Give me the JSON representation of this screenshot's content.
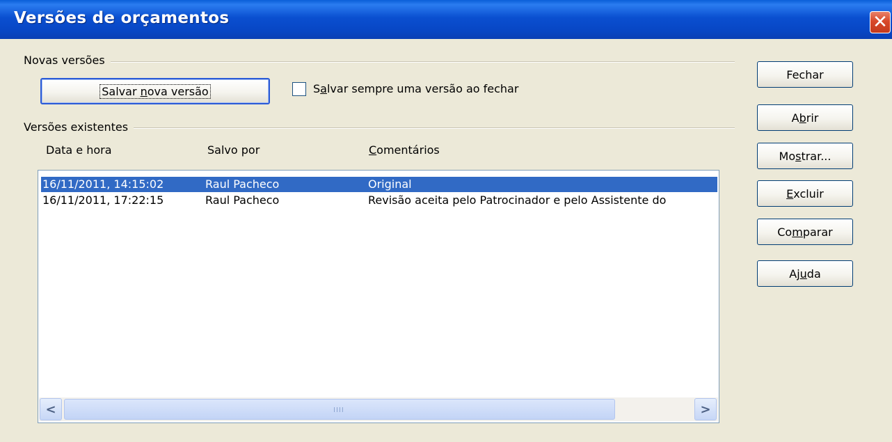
{
  "window": {
    "title": "Versões de orçamentos",
    "close_symbol": "✕"
  },
  "new_versions": {
    "group_label": "Novas versões",
    "save_button": {
      "pre": "Salvar ",
      "underlined": "n",
      "post": "ova versão"
    },
    "always_save": {
      "pre": "S",
      "underlined": "a",
      "post": "lvar sempre uma versão ao fechar",
      "checked": false
    }
  },
  "existing_versions": {
    "group_label": "Versões existentes",
    "columns": {
      "date": "Data e hora",
      "saved_by": "Salvo por",
      "comments_underlined": "C",
      "comments_rest": "omentários"
    },
    "rows": [
      {
        "date": "16/11/2011, 14:15:02",
        "saved_by": "Raul Pacheco",
        "comment": "Original",
        "selected": true
      },
      {
        "date": "16/11/2011, 17:22:15",
        "saved_by": "Raul Pacheco",
        "comment": "Revisão aceita pelo Patrocinador e pelo Assistente do",
        "selected": false
      }
    ],
    "scrollbar": {
      "left_arrow": "<",
      "right_arrow": ">",
      "grip": "IIII"
    }
  },
  "side_buttons": {
    "close": {
      "label": "Fechar"
    },
    "open": {
      "pre": "A",
      "underlined": "b",
      "post": "rir"
    },
    "show": {
      "pre": "Mo",
      "underlined": "s",
      "post": "trar..."
    },
    "delete": {
      "pre": "",
      "underlined": "E",
      "post": "xcluir"
    },
    "compare": {
      "pre": "Co",
      "underlined": "m",
      "post": "parar"
    },
    "help": {
      "pre": "Aj",
      "underlined": "u",
      "post": "da"
    }
  },
  "colors": {
    "titlebar": "#0a4fd0",
    "selection": "#316ac5",
    "dialog_bg": "#ece9d8"
  }
}
